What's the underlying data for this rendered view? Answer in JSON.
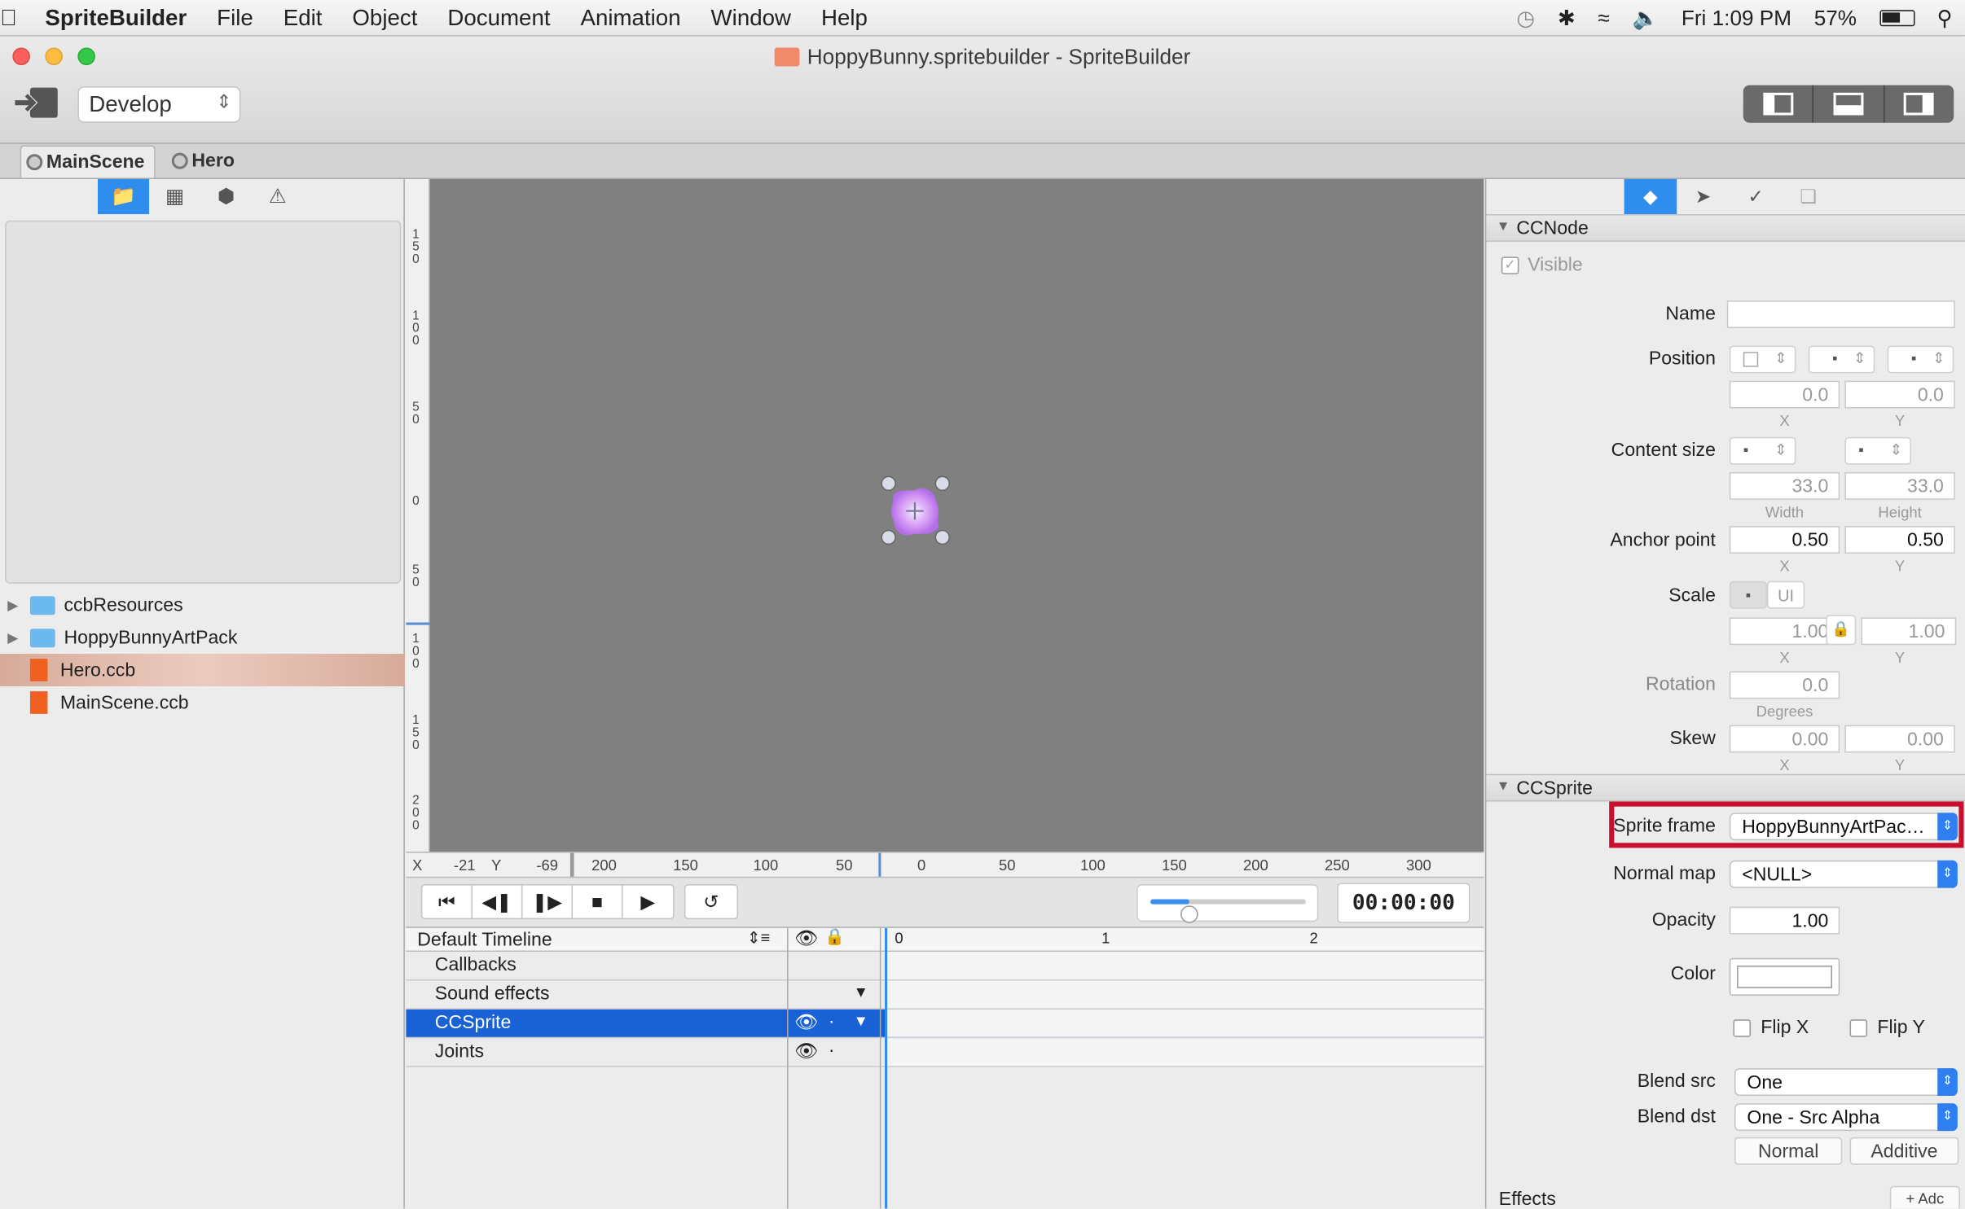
{
  "menubar": {
    "app_name": "SpriteBuilder",
    "items": [
      "File",
      "Edit",
      "Object",
      "Document",
      "Animation",
      "Window",
      "Help"
    ],
    "clock": "Fri 1:09 PM",
    "battery": "57%"
  },
  "window": {
    "title": "HoppyBunny.spritebuilder - SpriteBuilder",
    "mode": "Develop"
  },
  "tabs": [
    "MainScene",
    "Hero"
  ],
  "files": [
    {
      "name": "ccbResources",
      "type": "folder"
    },
    {
      "name": "HoppyBunnyArtPack",
      "type": "folder"
    },
    {
      "name": "Hero.ccb",
      "type": "ccb",
      "selected": true
    },
    {
      "name": "MainScene.ccb",
      "type": "ccb"
    }
  ],
  "canvas": {
    "cursor_x_label": "X",
    "cursor_x": "-21",
    "cursor_y_label": "Y",
    "cursor_y": "-69",
    "ruler_left": [
      "1\n5\n0",
      "1\n0\n0",
      "5\n0",
      "0",
      "5\n0",
      "1\n0\n0",
      "1\n5\n0",
      "2\n0\n0"
    ],
    "ruler_bottom": [
      "200",
      "150",
      "100",
      "50",
      "0",
      "50",
      "100",
      "150",
      "200",
      "250",
      "300"
    ]
  },
  "playback": {
    "timecode": "00:00:00",
    "zoom_level": 0.25
  },
  "timeline": {
    "name": "Default Timeline",
    "markers": [
      "0",
      "1",
      "2"
    ],
    "rows": [
      "Callbacks",
      "Sound effects",
      "CCSprite",
      "Joints"
    ]
  },
  "inspector": {
    "ccnode": {
      "header": "CCNode",
      "visible": "Visible",
      "name_label": "Name",
      "position_label": "Position",
      "pos_x": "0.0",
      "pos_y": "0.0",
      "x": "X",
      "y": "Y",
      "content_size_label": "Content size",
      "width": "33.0",
      "height": "33.0",
      "width_label": "Width",
      "height_label": "Height",
      "anchor_label": "Anchor point",
      "anchor_x": "0.50",
      "anchor_y": "0.50",
      "scale_label": "Scale",
      "scale_ui": "UI",
      "scale_x": "1.00",
      "scale_y": "1.00",
      "rotation_label": "Rotation",
      "rotation": "0.0",
      "degrees": "Degrees",
      "skew_label": "Skew",
      "skew_x": "0.00",
      "skew_y": "0.00"
    },
    "ccsprite": {
      "header": "CCSprite",
      "sprite_frame_label": "Sprite frame",
      "sprite_frame": "HoppyBunnyArtPac…",
      "normal_map_label": "Normal map",
      "normal_map": "<NULL>",
      "opacity_label": "Opacity",
      "opacity": "1.00",
      "color_label": "Color",
      "flip_x": "Flip X",
      "flip_y": "Flip Y",
      "blend_src_label": "Blend src",
      "blend_src": "One",
      "blend_dst_label": "Blend dst",
      "blend_dst": "One - Src Alpha",
      "normal_btn": "Normal",
      "additive_btn": "Additive"
    },
    "effects_label": "Effects",
    "add_btn": "Adc"
  },
  "colors": {
    "accent": "#2f8dee",
    "highlight_box": "#c8102e",
    "selection": "#1862d6"
  }
}
